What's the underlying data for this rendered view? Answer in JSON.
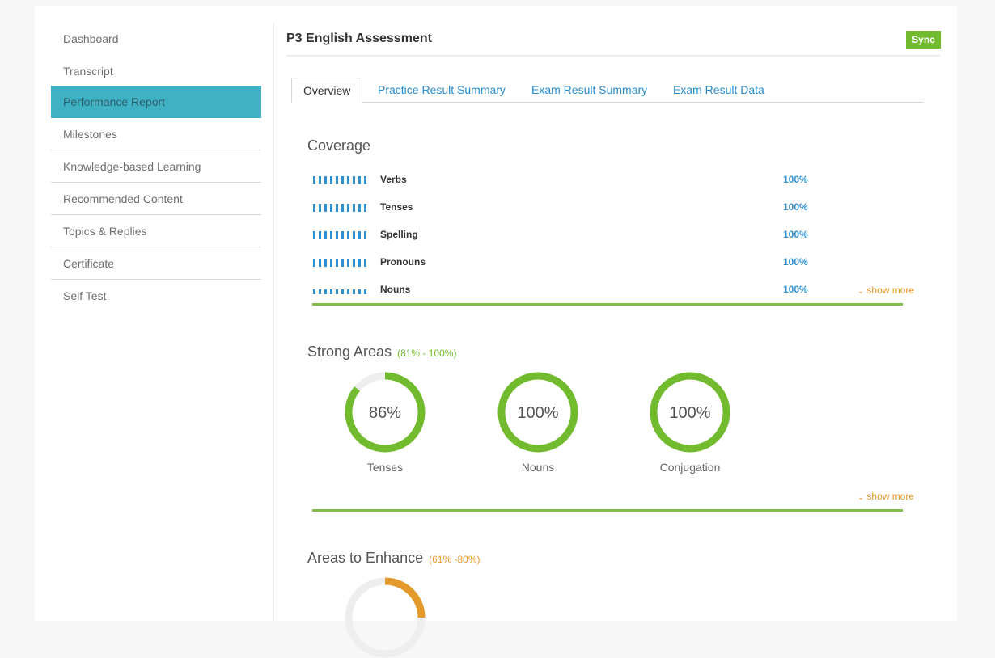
{
  "sidebar": {
    "items": [
      {
        "label": "Dashboard",
        "active": false
      },
      {
        "label": "Transcript",
        "active": false
      },
      {
        "label": "Performance Report",
        "active": true
      },
      {
        "label": "Milestones",
        "active": false
      },
      {
        "label": "Knowledge-based Learning",
        "active": false
      },
      {
        "label": "Recommended Content",
        "active": false
      },
      {
        "label": "Topics & Replies",
        "active": false
      },
      {
        "label": "Certificate",
        "active": false
      },
      {
        "label": "Self Test",
        "active": false
      }
    ]
  },
  "header": {
    "title": "P3 English Assessment",
    "sync_label": "Sync"
  },
  "tabs": [
    {
      "label": "Overview",
      "active": true
    },
    {
      "label": "Practice Result Summary",
      "active": false
    },
    {
      "label": "Exam Result Summary",
      "active": false
    },
    {
      "label": "Exam Result Data",
      "active": false
    }
  ],
  "coverage": {
    "title": "Coverage",
    "rows": [
      {
        "name": "Verbs",
        "percent": "100%"
      },
      {
        "name": "Tenses",
        "percent": "100%"
      },
      {
        "name": "Spelling",
        "percent": "100%"
      },
      {
        "name": "Pronouns",
        "percent": "100%"
      },
      {
        "name": "Nouns",
        "percent": "100%"
      }
    ],
    "show_more": "show more"
  },
  "strong_areas": {
    "title": "Strong Areas",
    "range": "(81% - 100%)",
    "items": [
      {
        "label": "Tenses",
        "value": 86,
        "text": "86%"
      },
      {
        "label": "Nouns",
        "value": 100,
        "text": "100%"
      },
      {
        "label": "Conjugation",
        "value": 100,
        "text": "100%"
      }
    ],
    "show_more": "show more"
  },
  "enhance_areas": {
    "title": "Areas to Enhance",
    "range": "(61% -80%)"
  },
  "colors": {
    "accent_teal": "#3fb1c4",
    "link_blue": "#2a8bc9",
    "strong_green": "#72bb2e",
    "enhance_orange": "#e39a2a"
  }
}
